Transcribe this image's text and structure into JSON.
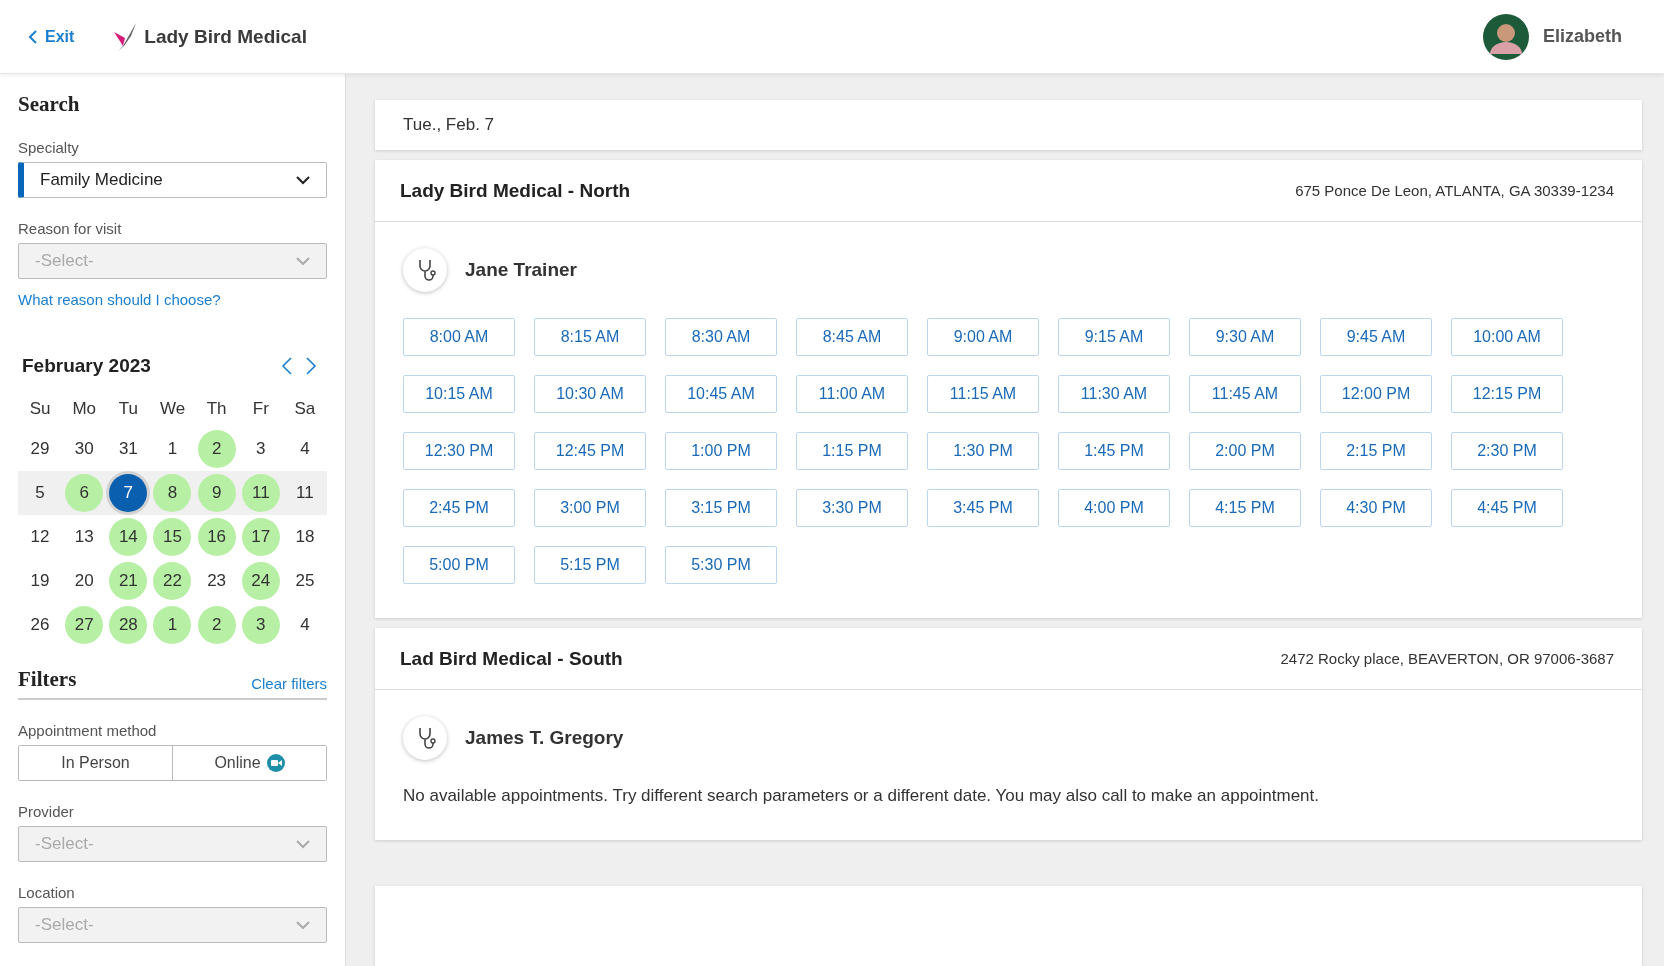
{
  "header": {
    "exit": "Exit",
    "brand": "Lady Bird Medical",
    "user": "Elizabeth"
  },
  "search": {
    "title": "Search",
    "specialty": {
      "label": "Specialty",
      "value": "Family Medicine"
    },
    "reason": {
      "label": "Reason for visit",
      "placeholder": "-Select-"
    },
    "help_link": "What reason should I choose?"
  },
  "calendar": {
    "month": "February 2023",
    "weekdays": [
      "Su",
      "Mo",
      "Tu",
      "We",
      "Th",
      "Fr",
      "Sa"
    ],
    "weeks": [
      {
        "highlighted": false,
        "days": [
          {
            "label": "29",
            "available": false,
            "selected": false
          },
          {
            "label": "30",
            "available": false,
            "selected": false
          },
          {
            "label": "31",
            "available": false,
            "selected": false
          },
          {
            "label": "1",
            "available": false,
            "selected": false
          },
          {
            "label": "2",
            "available": true,
            "selected": false
          },
          {
            "label": "3",
            "available": false,
            "selected": false
          },
          {
            "label": "4",
            "available": false,
            "selected": false
          }
        ]
      },
      {
        "highlighted": true,
        "days": [
          {
            "label": "5",
            "available": false,
            "selected": false
          },
          {
            "label": "6",
            "available": true,
            "selected": false
          },
          {
            "label": "7",
            "available": true,
            "selected": true
          },
          {
            "label": "8",
            "available": true,
            "selected": false
          },
          {
            "label": "9",
            "available": true,
            "selected": false
          },
          {
            "label": "11",
            "available": true,
            "selected": false
          },
          {
            "label": "11",
            "available": false,
            "selected": false
          }
        ]
      },
      {
        "highlighted": false,
        "days": [
          {
            "label": "12",
            "available": false,
            "selected": false
          },
          {
            "label": "13",
            "available": false,
            "selected": false
          },
          {
            "label": "14",
            "available": true,
            "selected": false
          },
          {
            "label": "15",
            "available": true,
            "selected": false
          },
          {
            "label": "16",
            "available": true,
            "selected": false
          },
          {
            "label": "17",
            "available": true,
            "selected": false
          },
          {
            "label": "18",
            "available": false,
            "selected": false
          }
        ]
      },
      {
        "highlighted": false,
        "days": [
          {
            "label": "19",
            "available": false,
            "selected": false
          },
          {
            "label": "20",
            "available": false,
            "selected": false
          },
          {
            "label": "21",
            "available": true,
            "selected": false
          },
          {
            "label": "22",
            "available": true,
            "selected": false
          },
          {
            "label": "23",
            "available": false,
            "selected": false
          },
          {
            "label": "24",
            "available": true,
            "selected": false
          },
          {
            "label": "25",
            "available": false,
            "selected": false
          }
        ]
      },
      {
        "highlighted": false,
        "days": [
          {
            "label": "26",
            "available": false,
            "selected": false
          },
          {
            "label": "27",
            "available": true,
            "selected": false
          },
          {
            "label": "28",
            "available": true,
            "selected": false
          },
          {
            "label": "1",
            "available": true,
            "selected": false
          },
          {
            "label": "2",
            "available": true,
            "selected": false
          },
          {
            "label": "3",
            "available": true,
            "selected": false
          },
          {
            "label": "4",
            "available": false,
            "selected": false
          }
        ]
      }
    ]
  },
  "filters": {
    "title": "Filters",
    "clear": "Clear filters",
    "method": {
      "label": "Appointment method",
      "options": [
        {
          "label": "In Person",
          "kind": "plain",
          "selected": false
        },
        {
          "label": "Online",
          "kind": "video",
          "selected": false
        }
      ]
    },
    "provider": {
      "label": "Provider",
      "placeholder": "-Select-"
    },
    "location": {
      "label": "Location",
      "placeholder": "-Select-"
    }
  },
  "date": "Tue., Feb. 7",
  "locations": [
    {
      "name": "Lady Bird Medical - North",
      "address": "675 Ponce De Leon, ATLANTA, GA 30339-1234",
      "provider": "Jane Trainer",
      "slots": [
        "8:00 AM",
        "8:15 AM",
        "8:30 AM",
        "8:45 AM",
        "9:00 AM",
        "9:15 AM",
        "9:30 AM",
        "9:45 AM",
        "10:00 AM",
        "10:15 AM",
        "10:30 AM",
        "10:45 AM",
        "11:00 AM",
        "11:15 AM",
        "11:30 AM",
        "11:45 AM",
        "12:00 PM",
        "12:15 PM",
        "12:30 PM",
        "12:45 PM",
        "1:00 PM",
        "1:15 PM",
        "1:30 PM",
        "1:45 PM",
        "2:00 PM",
        "2:15 PM",
        "2:30 PM",
        "2:45 PM",
        "3:00 PM",
        "3:15 PM",
        "3:30 PM",
        "3:45 PM",
        "4:00 PM",
        "4:15 PM",
        "4:30 PM",
        "4:45 PM",
        "5:00 PM",
        "5:15 PM",
        "5:30 PM"
      ]
    },
    {
      "name": "Lad Bird Medical - South",
      "address": "2472 Rocky place, BEAVERTON, OR 97006-3687",
      "provider": "James T. Gregory",
      "message": "No available appointments. Try different search parameters or a different date. You may also call to make an appointment."
    }
  ]
}
